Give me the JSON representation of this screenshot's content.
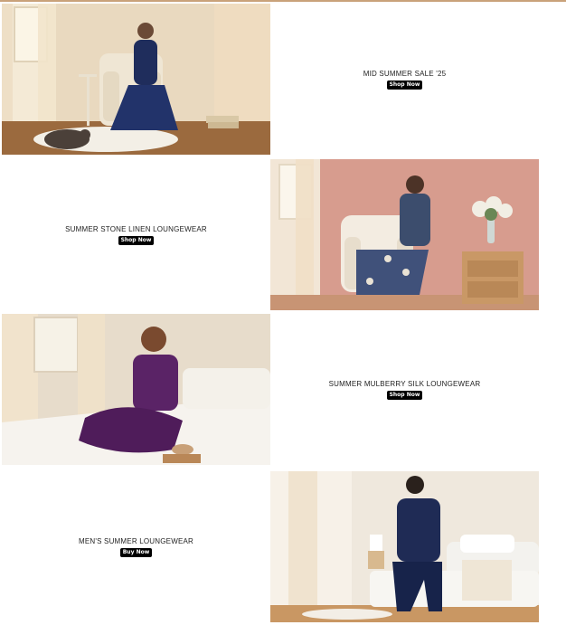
{
  "banners": [
    {
      "title": "MID SUMMER SALE '25",
      "button": "Shop Now",
      "image": "woman-blue-pajamas-armchair-with-cat"
    },
    {
      "title": "SUMMER STONE LINEN LOUNGEWEAR",
      "button": "Shop Now",
      "image": "woman-patterned-pajamas-armchair-pink-wall"
    },
    {
      "title": "SUMMER MULBERRY SILK LOUNGEWEAR",
      "button": "Shop Now",
      "image": "woman-purple-silk-pajamas-on-bed"
    },
    {
      "title": "MEN'S SUMMER LOUNGEWEAR",
      "button": "Buy Now",
      "image": "man-navy-pajamas-on-bed"
    }
  ],
  "colors": {
    "accent_line": "#c9a27a",
    "button_bg": "#000000",
    "button_text": "#ffffff"
  }
}
